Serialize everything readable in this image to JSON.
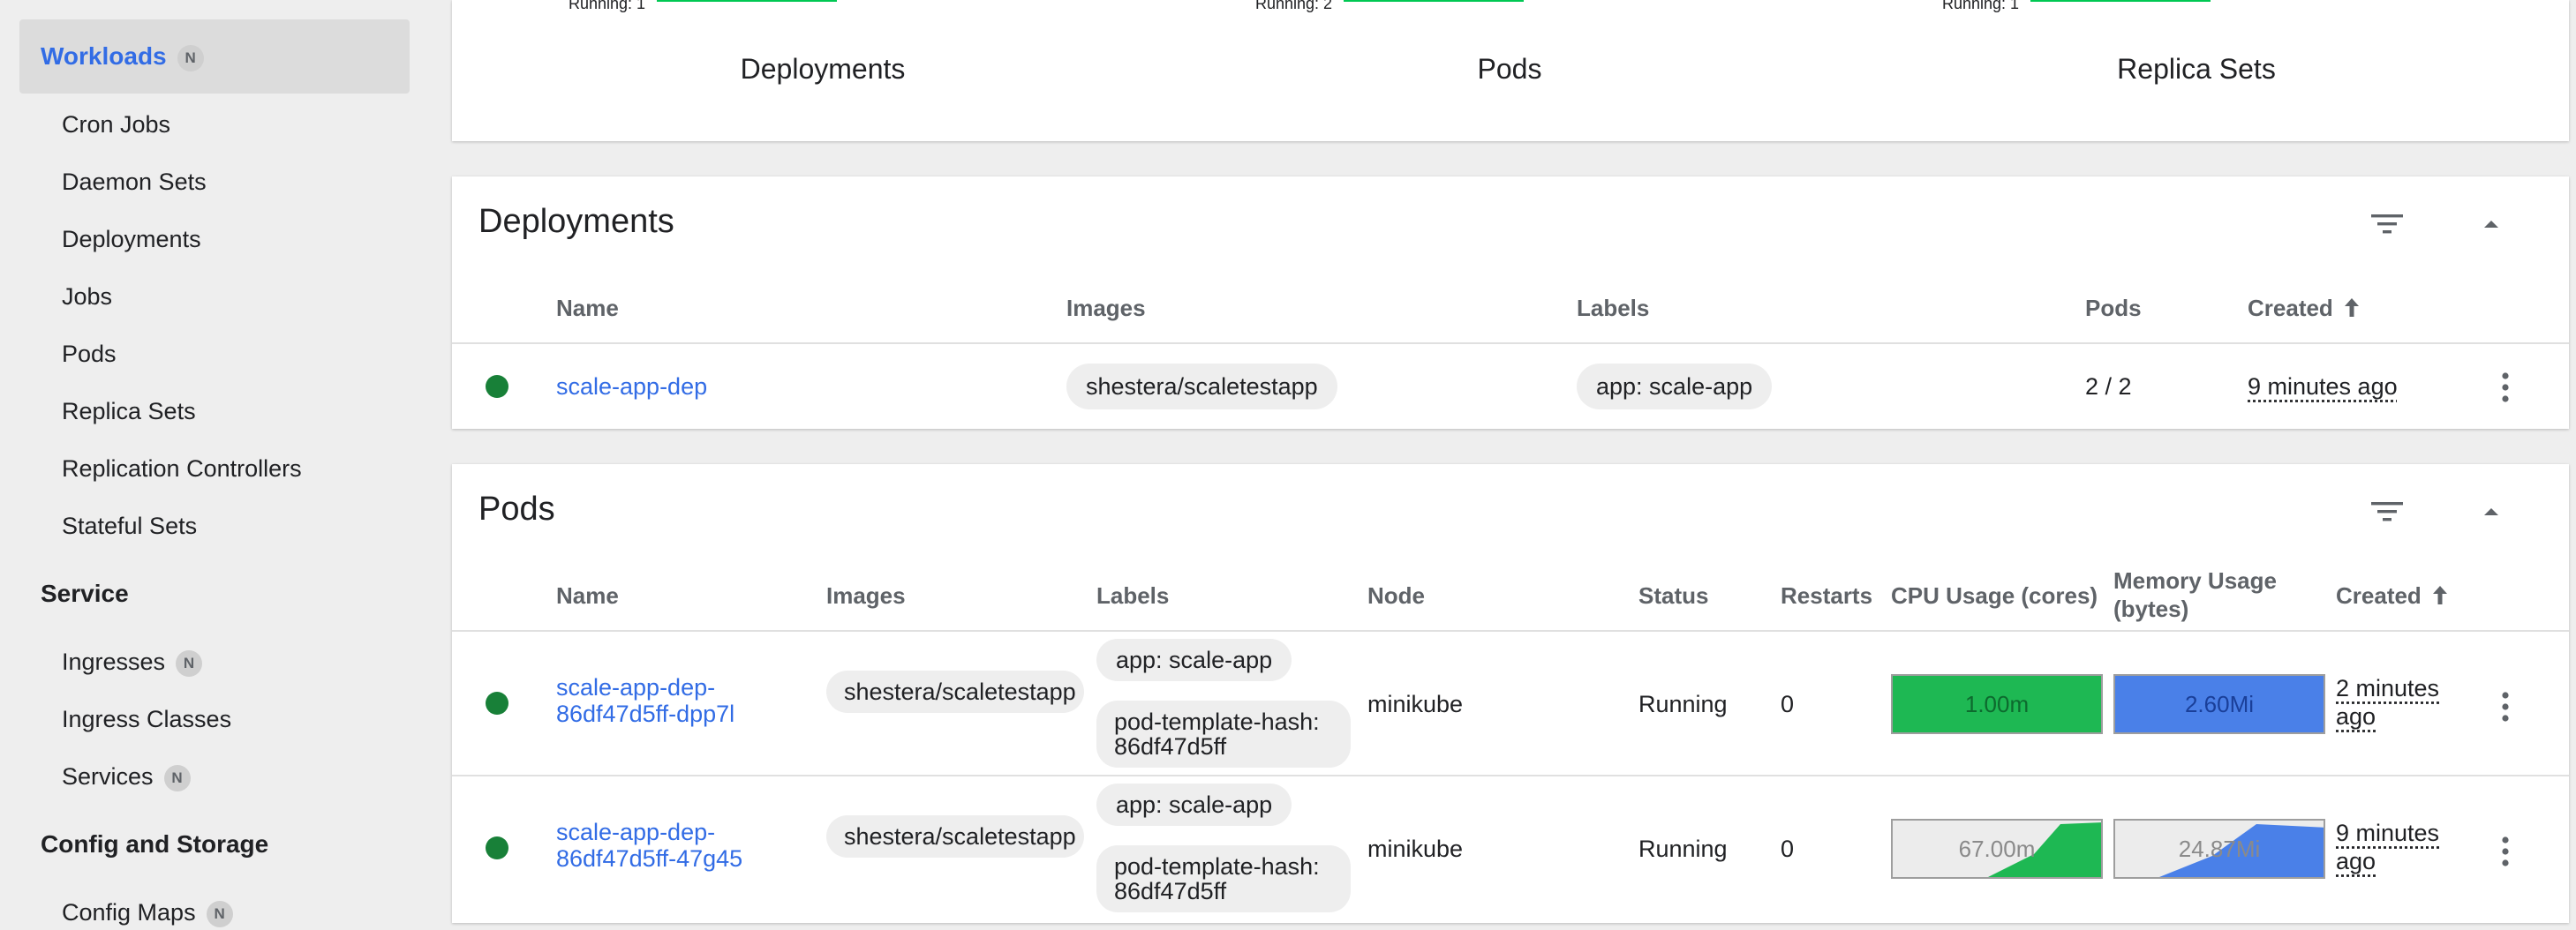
{
  "sidebar": {
    "workloads": {
      "label": "Workloads",
      "badge": "N"
    },
    "workload_items": [
      "Cron Jobs",
      "Daemon Sets",
      "Deployments",
      "Jobs",
      "Pods",
      "Replica Sets",
      "Replication Controllers",
      "Stateful Sets"
    ],
    "service": {
      "label": "Service",
      "items": [
        {
          "label": "Ingresses",
          "badge": "N"
        },
        {
          "label": "Ingress Classes"
        },
        {
          "label": "Services",
          "badge": "N"
        }
      ]
    },
    "config": {
      "label": "Config and Storage",
      "items": [
        {
          "label": "Config Maps",
          "badge": "N"
        }
      ]
    }
  },
  "summary": {
    "items": [
      {
        "label": "Deployments",
        "running": "Running: 1"
      },
      {
        "label": "Pods",
        "running": "Running: 2"
      },
      {
        "label": "Replica Sets",
        "running": "Running: 1"
      }
    ]
  },
  "deployments": {
    "title": "Deployments",
    "columns": {
      "name": "Name",
      "images": "Images",
      "labels": "Labels",
      "pods": "Pods",
      "created": "Created"
    },
    "rows": [
      {
        "name": "scale-app-dep",
        "image": "shestera/scaletestapp",
        "label": "app: scale-app",
        "pods": "2 / 2",
        "created": "9 minutes ago"
      }
    ]
  },
  "pods": {
    "title": "Pods",
    "columns": {
      "name": "Name",
      "images": "Images",
      "labels": "Labels",
      "node": "Node",
      "status": "Status",
      "restarts": "Restarts",
      "cpu": "CPU Usage (cores)",
      "memory": "Memory Usage (bytes)",
      "created": "Created"
    },
    "rows": [
      {
        "name": "scale-app-dep-86df47d5ff-dpp7l",
        "image": "shestera/scaletestapp",
        "label1": "app: scale-app",
        "label2": "pod-template-hash: 86df47d5ff",
        "node": "minikube",
        "status": "Running",
        "restarts": "0",
        "cpu": "1.00m",
        "memory": "2.60Mi",
        "created": "2 minutes ago"
      },
      {
        "name": "scale-app-dep-86df47d5ff-47g45",
        "image": "shestera/scaletestapp",
        "label1": "app: scale-app",
        "label2": "pod-template-hash: 86df47d5ff",
        "node": "minikube",
        "status": "Running",
        "restarts": "0",
        "cpu": "67.00m",
        "memory": "24.87Mi",
        "created": "9 minutes ago"
      }
    ]
  },
  "colors": {
    "accent": "#326ce5",
    "success": "#188038",
    "cpu": "#1eb853",
    "memory": "#4a80e8"
  }
}
